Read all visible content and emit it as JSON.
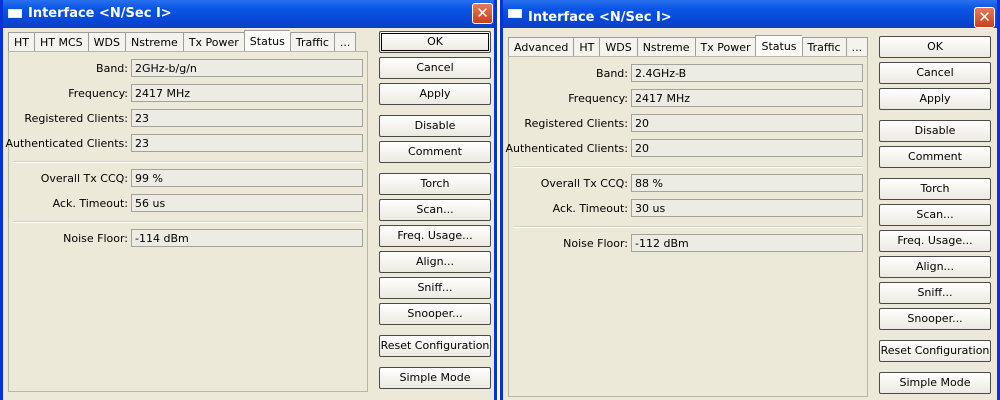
{
  "left": {
    "title": "Interface <N/Sec I>",
    "close_glyph": "✕",
    "tabs": [
      "HT",
      "HT MCS",
      "WDS",
      "Nstreme",
      "Tx Power",
      "Status",
      "Traffic",
      "..."
    ],
    "fields": {
      "band": {
        "label": "Band:",
        "value": "2GHz-b/g/n"
      },
      "frequency": {
        "label": "Frequency:",
        "value": "2417 MHz"
      },
      "registered_clients": {
        "label": "Registered Clients:",
        "value": "23"
      },
      "authenticated_clients": {
        "label": "Authenticated Clients:",
        "value": "23"
      },
      "overall_tx_ccq": {
        "label": "Overall Tx CCQ:",
        "value": "99 %"
      },
      "ack_timeout": {
        "label": "Ack. Timeout:",
        "value": "56 us"
      },
      "noise_floor": {
        "label": "Noise Floor:",
        "value": "-114 dBm"
      }
    },
    "buttons": {
      "ok": "OK",
      "cancel": "Cancel",
      "apply": "Apply",
      "disable": "Disable",
      "comment": "Comment",
      "torch": "Torch",
      "scan": "Scan...",
      "freq_usage": "Freq. Usage...",
      "align": "Align...",
      "sniff": "Sniff...",
      "snooper": "Snooper...",
      "reset_configuration": "Reset Configuration",
      "simple_mode": "Simple Mode"
    }
  },
  "right": {
    "title": "Interface <N/Sec I>",
    "close_glyph": "✕",
    "tabs": [
      "Advanced",
      "HT",
      "WDS",
      "Nstreme",
      "Tx Power",
      "Status",
      "Traffic",
      "..."
    ],
    "fields": {
      "band": {
        "label": "Band:",
        "value": "2.4GHz-B"
      },
      "frequency": {
        "label": "Frequency:",
        "value": "2417 MHz"
      },
      "registered_clients": {
        "label": "Registered Clients:",
        "value": "20"
      },
      "authenticated_clients": {
        "label": "Authenticated Clients:",
        "value": "20"
      },
      "overall_tx_ccq": {
        "label": "Overall Tx CCQ:",
        "value": "88 %"
      },
      "ack_timeout": {
        "label": "Ack. Timeout:",
        "value": "30 us"
      },
      "noise_floor": {
        "label": "Noise Floor:",
        "value": "-112 dBm"
      }
    },
    "buttons": {
      "ok": "OK",
      "cancel": "Cancel",
      "apply": "Apply",
      "disable": "Disable",
      "comment": "Comment",
      "torch": "Torch",
      "scan": "Scan...",
      "freq_usage": "Freq. Usage...",
      "align": "Align...",
      "sniff": "Sniff...",
      "snooper": "Snooper...",
      "reset_configuration": "Reset Configuration",
      "simple_mode": "Simple Mode"
    }
  },
  "colors": {
    "titlebar": "#0a56e4",
    "close_button": "#c6401d",
    "window_bg": "#ece9d8"
  }
}
